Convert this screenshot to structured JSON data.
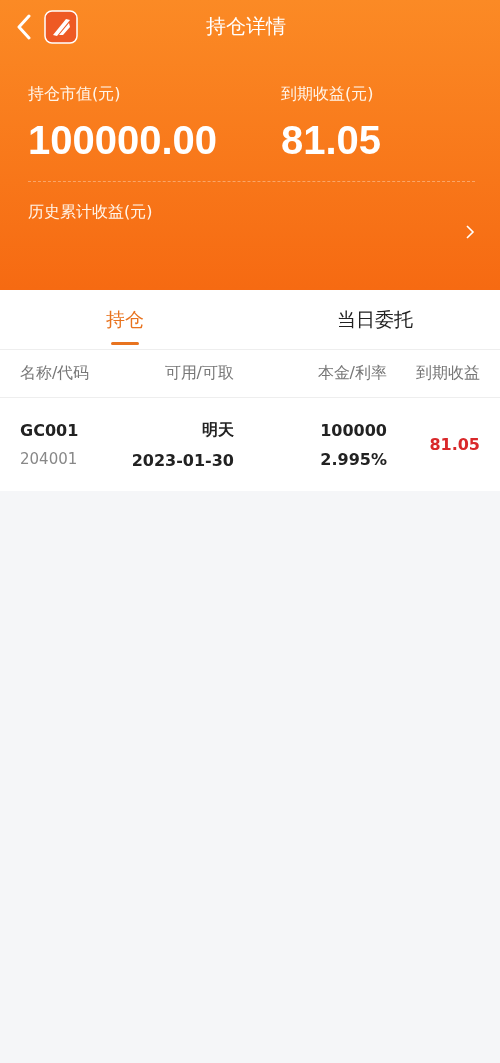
{
  "header": {
    "title": "持仓详情",
    "market_value": {
      "label": "持仓市值(元)",
      "value": "100000.00"
    },
    "expected_income": {
      "label": "到期收益(元)",
      "value": "81.05"
    },
    "history": {
      "label": "历史累计收益(元)"
    }
  },
  "tabs": [
    {
      "label": "持仓",
      "selected": true
    },
    {
      "label": "当日委托",
      "selected": false
    }
  ],
  "table": {
    "columns": [
      "名称/代码",
      "可用/可取",
      "本金/利率",
      "到期收益"
    ],
    "rows": [
      {
        "name": "GC001",
        "code": "204001",
        "available": "明天",
        "withdrawable": "2023-01-30",
        "principal": "100000",
        "rate": "2.995%",
        "income": "81.05"
      }
    ]
  }
}
